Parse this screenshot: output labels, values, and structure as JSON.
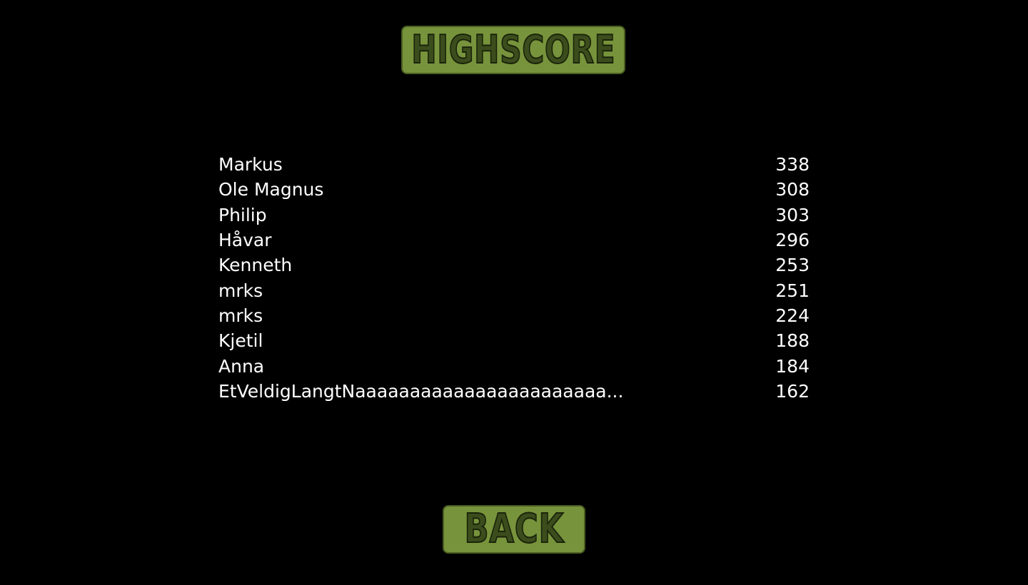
{
  "title": "HIGHSCORE",
  "scores": [
    {
      "name": "Markus",
      "score": "338"
    },
    {
      "name": "Ole Magnus",
      "score": "308"
    },
    {
      "name": "Philip",
      "score": "303"
    },
    {
      "name": "Håvar",
      "score": "296"
    },
    {
      "name": "Kenneth",
      "score": "253"
    },
    {
      "name": "mrks",
      "score": "251"
    },
    {
      "name": "mrks",
      "score": "224"
    },
    {
      "name": "Kjetil",
      "score": "188"
    },
    {
      "name": "Anna",
      "score": "184"
    },
    {
      "name": "EtVeldigLangtNaaaaaaaaaaaaaaaaaaaaaaa...",
      "score": "162"
    }
  ],
  "back_label": "BACK",
  "colors": {
    "background": "#000000",
    "button_fill": "#77933c",
    "button_text": "#3b4d1c",
    "text": "#ffffff"
  }
}
